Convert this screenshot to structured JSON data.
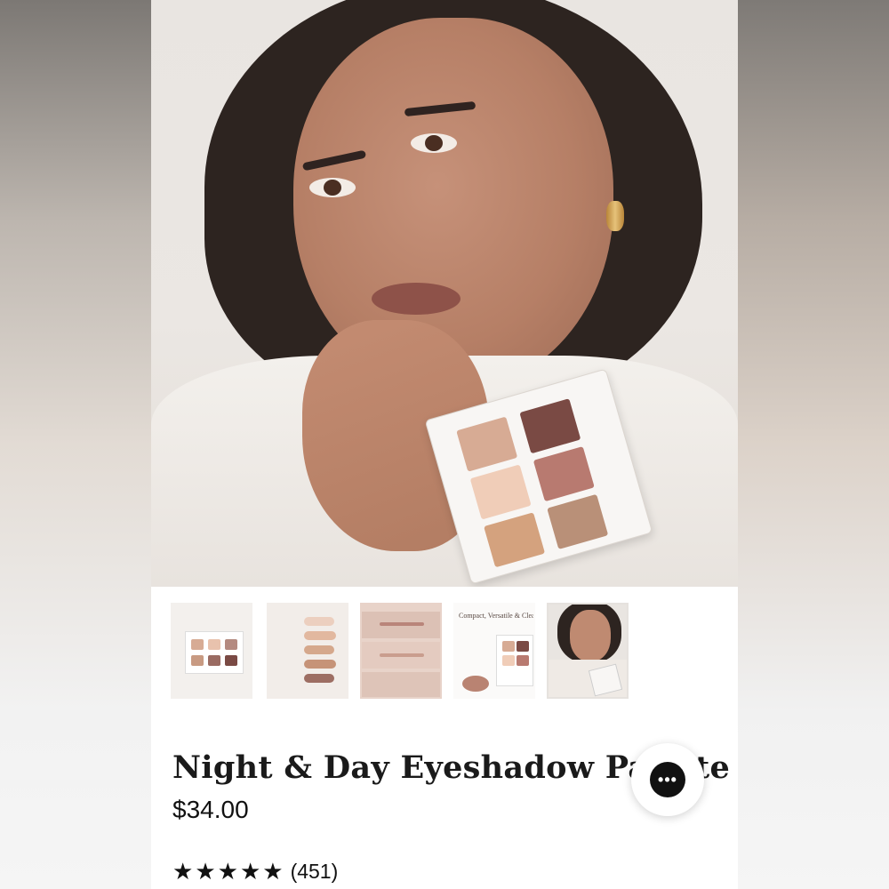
{
  "product": {
    "title": "Night & Day Eyeshadow Palette",
    "price": "$34.00",
    "rating": 5,
    "review_count": "(451)"
  },
  "thumbnails": [
    {
      "label": "palette-flatlay"
    },
    {
      "label": "swatches"
    },
    {
      "label": "arm-swatches"
    },
    {
      "label": "compact-versatile-clean",
      "title": "Compact, Versatile & Clean"
    },
    {
      "label": "model",
      "active": true
    }
  ],
  "chat": {
    "icon": "chat-bubble-icon",
    "glyph": "•••"
  },
  "colors": {
    "pan_1": "#d7ab94",
    "pan_2": "#7a4a44",
    "pan_3": "#f0cdb8",
    "pan_4": "#b87a70",
    "pan_5": "#d4a27e",
    "pan_6": "#b99078"
  }
}
